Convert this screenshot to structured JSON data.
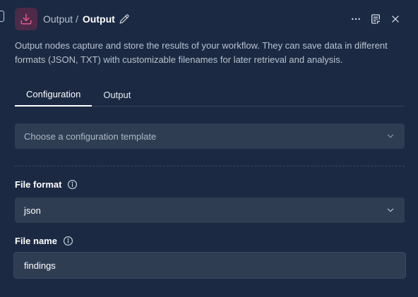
{
  "header": {
    "icon": "download-icon",
    "breadcrumb_parent": "Output",
    "breadcrumb_separator": "/",
    "title": "Output",
    "actions": [
      "more-icon",
      "notes-icon",
      "close-icon"
    ],
    "accent_color": "#4d2a48",
    "icon_color": "#e25b8e"
  },
  "description": "Output nodes capture and store the results of your workflow. They can save data in different formats (JSON, TXT) with customizable filenames for later retrieval and analysis.",
  "tabs": [
    {
      "label": "Configuration",
      "active": true
    },
    {
      "label": "Output",
      "active": false
    }
  ],
  "template_select": {
    "placeholder": "Choose a configuration template"
  },
  "file_format": {
    "label": "File format",
    "value": "json"
  },
  "file_name": {
    "label": "File name",
    "value": "findings"
  }
}
